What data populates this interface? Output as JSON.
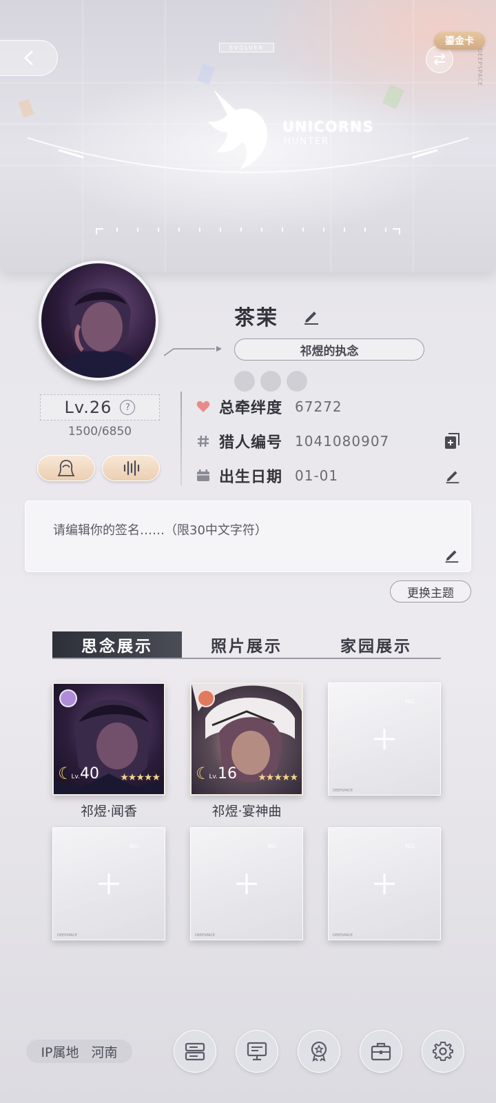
{
  "header": {
    "evolver_tag": "EVOLVER",
    "logo_title": "UNICORNS",
    "logo_subtitle": "HUNTER",
    "gold_card_label": "鎏金卡",
    "side_brand": "DEEPSPACE"
  },
  "profile": {
    "nickname": "茶茉",
    "title": "祁煜的执念",
    "level": "Lv.26",
    "exp": "1500/6850",
    "stats": [
      {
        "label": "总牵绊度",
        "value": "67272",
        "icon": "heart-icon"
      },
      {
        "label": "猎人编号",
        "value": "1041080907",
        "icon": "hash-icon"
      },
      {
        "label": "出生日期",
        "value": "01-01",
        "icon": "calendar-icon"
      }
    ]
  },
  "signature": {
    "placeholder": "请编辑你的签名……（限30中文字符）"
  },
  "theme_button": "更换主题",
  "tabs": [
    {
      "label": "思念展示",
      "active": true
    },
    {
      "label": "照片展示",
      "active": false
    },
    {
      "label": "家园展示",
      "active": false
    }
  ],
  "cards": [
    {
      "name": "祁煜·闻香",
      "level": "40",
      "lv_prefix": "Lv.",
      "stars": "★★★★★",
      "rarity_color": "#b08cd8"
    },
    {
      "name": "祁煜·宴神曲",
      "level": "16",
      "lv_prefix": "Lv.",
      "stars": "★★★★★",
      "rarity_color": "#e07a5f"
    }
  ],
  "empty_slot": {
    "no_label": "NO.",
    "footer": "DEEPSPACE"
  },
  "footer": {
    "ip_label": "IP属地",
    "ip_value": "河南"
  },
  "colors": {
    "accent_gold": "#e7c8a2",
    "heart": "#e98a8a",
    "tab_active": "#2d3038"
  }
}
